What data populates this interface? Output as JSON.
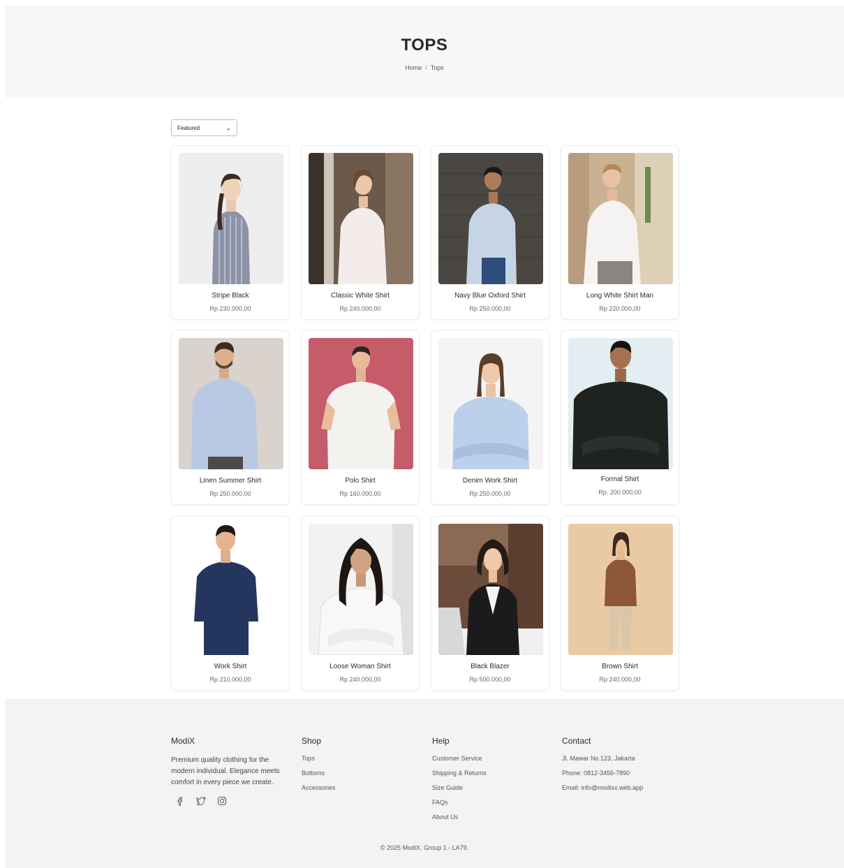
{
  "header": {
    "title": "TOPS",
    "breadcrumb": {
      "home": "Home",
      "separator": "/",
      "current": "Tops"
    }
  },
  "sort": {
    "selected": "Featured"
  },
  "products": [
    {
      "name": "Stripe Black",
      "price": "Rp 230.000,00"
    },
    {
      "name": "Classic White Shirt",
      "price": "Rp 240.000,00"
    },
    {
      "name": "Navy Blue Oxford Shirt",
      "price": "Rp 250.000,00"
    },
    {
      "name": "Long White Shirt Man",
      "price": "Rp 220.000,00"
    },
    {
      "name": "Linen Summer Shirt",
      "price": "Rp 250.000,00"
    },
    {
      "name": "Polo Shirt",
      "price": "Rp 160.000,00"
    },
    {
      "name": "Denim Work Shirt",
      "price": "Rp 250.000,00"
    },
    {
      "name": "Formal Shirt",
      "price": "Rp. 200.000,00"
    },
    {
      "name": "Work Shirt",
      "price": "Rp 210.000,00"
    },
    {
      "name": "Loose Woman Shirt",
      "price": "Rp 240.000,00"
    },
    {
      "name": "Black Blazer",
      "price": "Rp 500.000,00"
    },
    {
      "name": "Brown Shirt",
      "price": "Rp 240.000,00"
    }
  ],
  "footer": {
    "brand": {
      "title": "ModiX",
      "description": "Premium quality clothing for the modern individual. Elegance meets comfort in every piece we create."
    },
    "shop": {
      "title": "Shop",
      "links": [
        "Tops",
        "Bottoms",
        "Accessories"
      ]
    },
    "help": {
      "title": "Help",
      "links": [
        "Customer Service",
        "Shipping & Returns",
        "Size Guide",
        "FAQs",
        "About Us"
      ]
    },
    "contact": {
      "title": "Contact",
      "lines": [
        "Jl. Mawar No.123, Jakarta",
        "Phone: 0812-3456-7890",
        "Email: info@modixx.web.app"
      ]
    },
    "copyright": "© 2025 ModiX. Group 1 - LA79."
  }
}
